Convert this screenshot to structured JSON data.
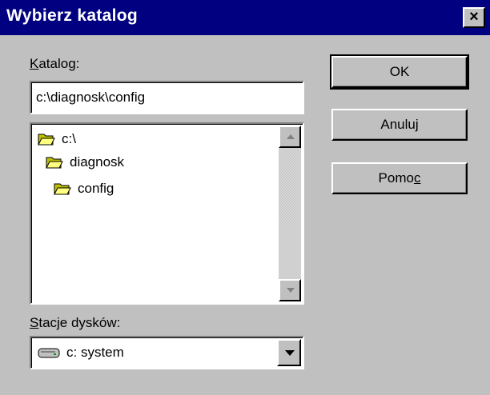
{
  "dialog": {
    "title": "Wybierz katalog",
    "close_label": "×"
  },
  "directory": {
    "label_mnemonic": "K",
    "label_rest": "atalog:",
    "path_value": "c:\\diagnosk\\config"
  },
  "folder_tree": {
    "items": [
      {
        "label": "c:\\",
        "icon": "open-folder-icon"
      },
      {
        "label": "diagnosk",
        "icon": "open-folder-icon"
      },
      {
        "label": "config",
        "icon": "open-folder-icon"
      }
    ]
  },
  "drives": {
    "label_mnemonic": "S",
    "label_rest": "tacje dysków:",
    "selected": "c: system",
    "icon": "hard-drive-icon"
  },
  "buttons": {
    "ok": "OK",
    "cancel": "Anuluj",
    "help_prefix": "Pomo",
    "help_mnemonic": "c"
  },
  "colors": {
    "titlebar": "#000080",
    "face": "#c0c0c0",
    "folder": "#ffff80"
  }
}
